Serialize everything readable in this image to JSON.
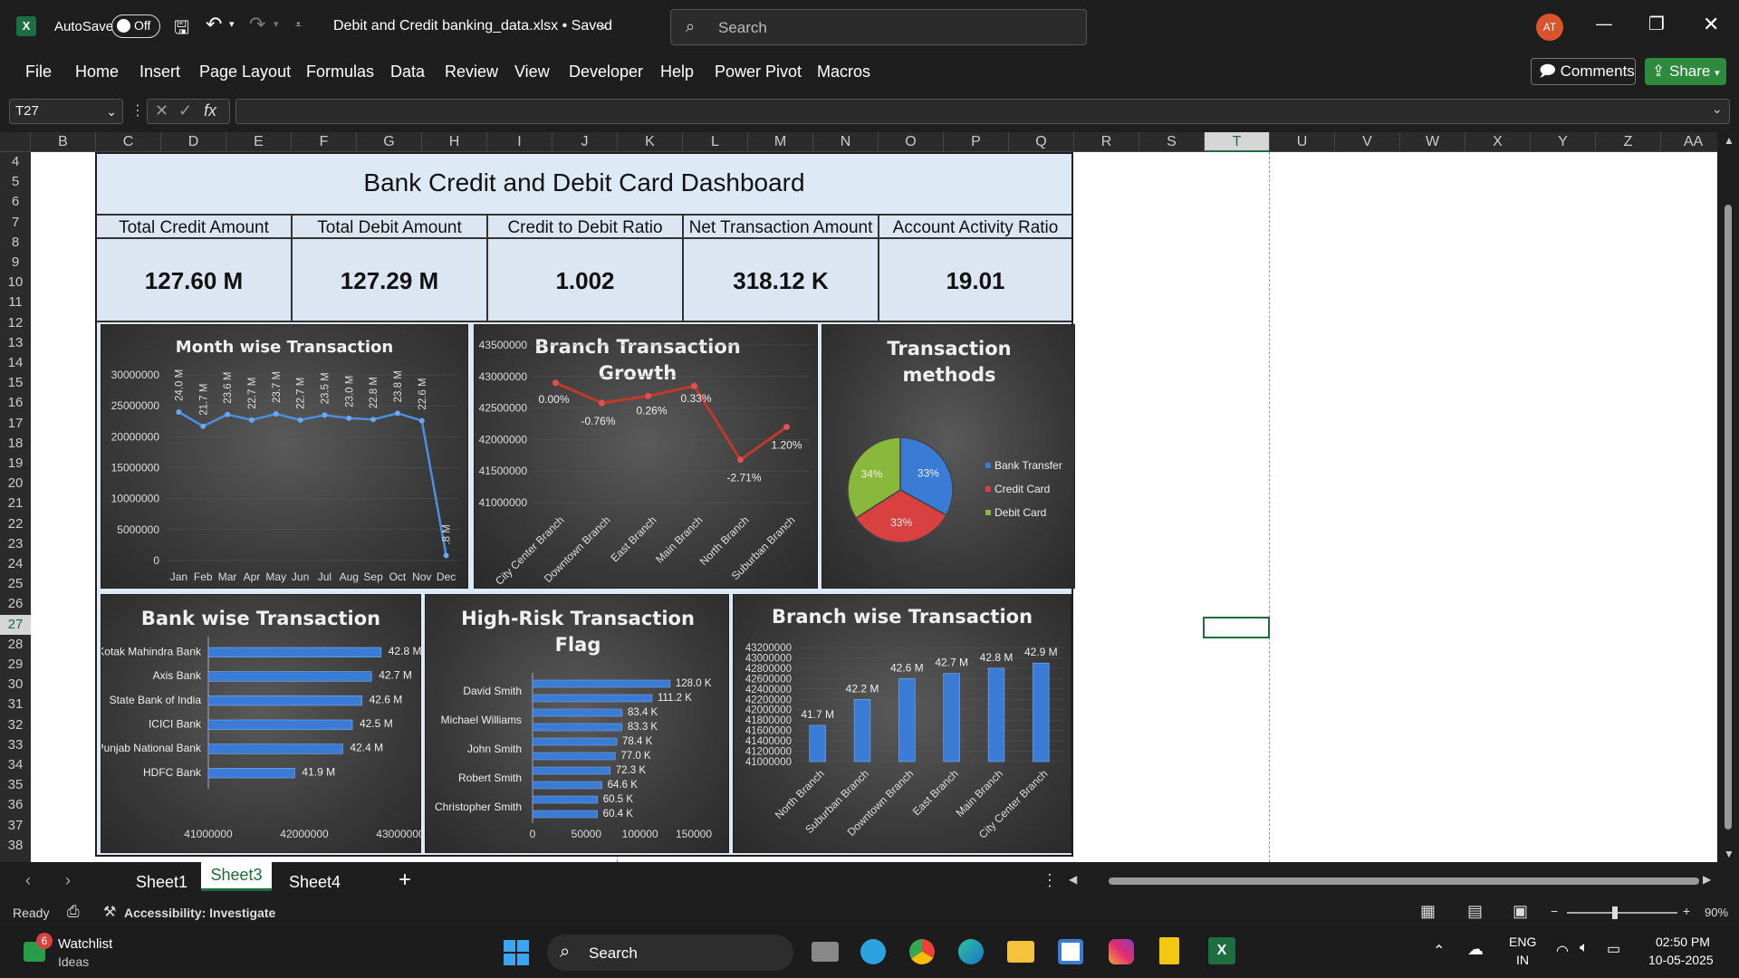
{
  "window": {
    "autosave_label": "AutoSave",
    "autosave_state": "Off",
    "file_title": "Debit and Credit banking_data.xlsx • Saved",
    "search_placeholder": "Search",
    "avatar": "AT"
  },
  "menu": {
    "items": [
      "File",
      "Home",
      "Insert",
      "Page Layout",
      "Formulas",
      "Data",
      "Review",
      "View",
      "Developer",
      "Help",
      "Power Pivot",
      "Macros"
    ],
    "comments": "Comments",
    "share": "Share"
  },
  "formula": {
    "name_box": "T27",
    "fx": "fx",
    "value": ""
  },
  "columns": [
    "B",
    "C",
    "D",
    "E",
    "F",
    "G",
    "H",
    "I",
    "J",
    "K",
    "L",
    "M",
    "N",
    "O",
    "P",
    "Q",
    "R",
    "S",
    "T",
    "U",
    "V",
    "W",
    "X",
    "Y",
    "Z",
    "AA"
  ],
  "rows": [
    "4",
    "5",
    "6",
    "7",
    "8",
    "9",
    "10",
    "11",
    "12",
    "13",
    "14",
    "15",
    "16",
    "17",
    "18",
    "19",
    "20",
    "21",
    "22",
    "23",
    "24",
    "25",
    "26",
    "27",
    "28",
    "29",
    "30",
    "31",
    "32",
    "33",
    "34",
    "35",
    "36",
    "37",
    "38"
  ],
  "dashboard": {
    "title": "Bank Credit and Debit Card Dashboard",
    "kpis": [
      {
        "label": "Total Credit Amount",
        "value": "127.60 M"
      },
      {
        "label": "Total Debit Amount",
        "value": "127.29 M"
      },
      {
        "label": "Credit to Debit  Ratio",
        "value": "1.002"
      },
      {
        "label": "Net Transaction Amount",
        "value": "318.12 K"
      },
      {
        "label": "Account Activity Ratio",
        "value": "19.01"
      }
    ]
  },
  "chart_data": [
    {
      "type": "line",
      "title": "Month wise Transaction",
      "categories": [
        "Jan",
        "Feb",
        "Mar",
        "Apr",
        "May",
        "Jun",
        "Jul",
        "Aug",
        "Sep",
        "Oct",
        "Nov",
        "Dec"
      ],
      "values": [
        24000000,
        21700000,
        23600000,
        22700000,
        23700000,
        22700000,
        23500000,
        23000000,
        22800000,
        23800000,
        22600000,
        800000
      ],
      "labels": [
        "24.0 M",
        "21.7 M",
        "23.6 M",
        "22.7 M",
        "23.7 M",
        "22.7 M",
        "23.5 M",
        "23.0 M",
        "22.8 M",
        "23.8 M",
        "22.6 M",
        ".8 M"
      ],
      "yticks": [
        "30000000",
        "25000000",
        "20000000",
        "15000000",
        "10000000",
        "5000000",
        "0"
      ],
      "ylim": [
        0,
        30000000
      ]
    },
    {
      "type": "line",
      "title": "Branch Transaction Growth",
      "categories": [
        "City Center Branch",
        "Downtown Branch",
        "East Branch",
        "Main Branch",
        "North Branch",
        "Suburban Branch"
      ],
      "values": [
        42900000,
        42580000,
        42690000,
        42850000,
        41680000,
        42200000
      ],
      "labels": [
        "0.00%",
        "-0.76%",
        "0.26%",
        "0.33%",
        "-2.71%",
        "1.20%"
      ],
      "yticks": [
        "43500000",
        "43000000",
        "42500000",
        "42000000",
        "41500000",
        "41000000"
      ],
      "ylim": [
        41000000,
        43500000
      ]
    },
    {
      "type": "pie",
      "title": "Transaction methods",
      "series": [
        {
          "name": "Bank Transfer",
          "value": 33,
          "label": "33%",
          "color": "#3a7bd5"
        },
        {
          "name": "Credit Card",
          "value": 33,
          "label": "33%",
          "color": "#d94040"
        },
        {
          "name": "Debit Card",
          "value": 34,
          "label": "34%",
          "color": "#8ab83a"
        }
      ]
    },
    {
      "type": "bar",
      "title": "Bank wise Transaction",
      "categories": [
        "Kotak Mahindra Bank",
        "Axis Bank",
        "State Bank of India",
        "ICICI Bank",
        "Punjab National Bank",
        "HDFC Bank"
      ],
      "values": [
        42.8,
        42.7,
        42.6,
        42.5,
        42.4,
        41.9
      ],
      "labels": [
        "42.8 M",
        "42.7 M",
        "42.6 M",
        "42.5 M",
        "42.4 M",
        "41.9 M"
      ],
      "xticks": [
        "41000000",
        "42000000",
        "43000000"
      ],
      "xlim": [
        41,
        43
      ]
    },
    {
      "type": "bar",
      "title": "High-Risk Transaction Flag",
      "categories": [
        "David Smith",
        "Michael Williams",
        "John Smith",
        "Robert Smith",
        "Christopher Smith"
      ],
      "values": [
        128.0,
        111.2,
        83.4,
        83.3,
        78.4,
        77.0,
        72.3,
        64.6,
        60.5,
        60.4
      ],
      "labels": [
        "128.0 K",
        "111.2 K",
        "83.4 K",
        "83.3 K",
        "78.4 K",
        "77.0 K",
        "72.3 K",
        "64.6 K",
        "60.5 K",
        "60.4 K"
      ],
      "xticks": [
        "0",
        "50000",
        "100000",
        "150000"
      ],
      "xlim": [
        0,
        150
      ]
    },
    {
      "type": "bar",
      "title": "Branch wise Transaction",
      "categories": [
        "North Branch",
        "Suburban Branch",
        "Downtown Branch",
        "East Branch",
        "Main Branch",
        "City Center Branch"
      ],
      "values": [
        41.7,
        42.2,
        42.6,
        42.7,
        42.8,
        42.9
      ],
      "labels": [
        "41.7 M",
        "42.2 M",
        "42.6 M",
        "42.7 M",
        "42.8 M",
        "42.9 M"
      ],
      "yticks": [
        "43200000",
        "43000000",
        "42800000",
        "42600000",
        "42400000",
        "42200000",
        "42000000",
        "41800000",
        "41600000",
        "41400000",
        "41200000",
        "41000000"
      ],
      "ylim": [
        41.0,
        43.2
      ]
    }
  ],
  "sheets": {
    "tabs": [
      "Sheet1",
      "Sheet3",
      "Sheet4"
    ],
    "active": "Sheet3",
    "add": "+"
  },
  "status": {
    "ready": "Ready",
    "accessibility": "Accessibility: Investigate",
    "zoom": "90%"
  },
  "taskbar": {
    "watchlist": "Watchlist",
    "ideas": "Ideas",
    "badge": "6",
    "search": "Search",
    "lang1": "ENG",
    "lang2": "IN",
    "time": "02:50 PM",
    "date": "10-05-2025"
  }
}
